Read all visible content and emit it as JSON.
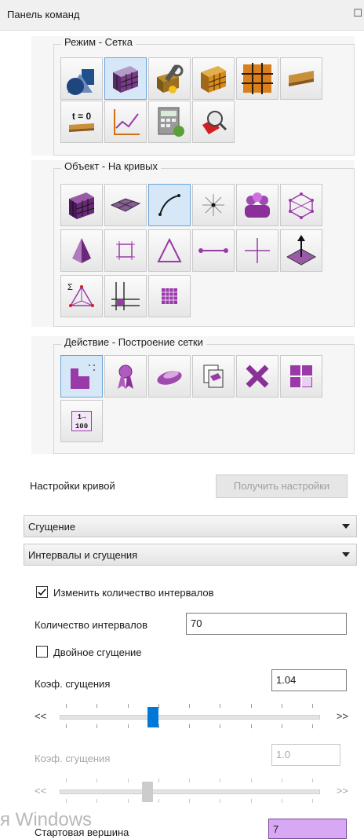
{
  "panel": {
    "title": "Панель команд"
  },
  "groups": {
    "mode": {
      "title": "Режим - Сетка"
    },
    "object": {
      "title": "Объект - На кривых"
    },
    "action": {
      "title": "Действие - Построение сетки"
    }
  },
  "mode_buttons": [
    "geometry-icon",
    "block-mesh-icon",
    "mesh-settings-icon",
    "hexa-block-icon",
    "grid-edges-icon",
    "bar-element-icon",
    "time-zero-icon",
    "graph-icon",
    "calculator-icon",
    "inspect-icon"
  ],
  "time_label": "t = 0",
  "object_buttons": [
    "volume-mesh-icon",
    "surface-mesh-icon",
    "curve-mesh-icon",
    "vertex-star-icon",
    "parts-icon",
    "topology-icon",
    "prism-icon",
    "edge-rect-icon",
    "triangle-icon",
    "line-segment-icon",
    "point-cross-icon",
    "normal-vector-icon",
    "sigma-tetra-icon",
    "structure-lines-icon",
    "grid-small-icon"
  ],
  "action_buttons": [
    "build-mesh-icon",
    "ribbon-icon",
    "smooth-icon",
    "copy-icon",
    "delete-icon",
    "split-block-icon",
    "numbering-icon"
  ],
  "numbering_label": "1→ 100",
  "curve_settings": {
    "label": "Настройки кривой",
    "get_button": "Получить настройки"
  },
  "combo1": {
    "value": "Сгущение"
  },
  "combo2": {
    "value": "Интервалы и сгущения"
  },
  "change_intervals": {
    "label": "Изменить количество интервалов",
    "checked": true
  },
  "interval_count": {
    "label": "Количество интервалов",
    "value": "70"
  },
  "double_bunching": {
    "label": "Двойное сгущение",
    "checked": false
  },
  "coef1": {
    "label": "Коэф. сгущения",
    "value": "1.04",
    "slider_level": 0.36
  },
  "coef2": {
    "label": "Коэф. сгущения",
    "value": "1.0",
    "slider_level": 0.34
  },
  "slider_left": "<<",
  "slider_right": ">>",
  "start_vertex": {
    "label": "Стартовая вершина",
    "value": "7"
  },
  "watermark": "я Windows",
  "colors": {
    "accent": "#0078d7",
    "highlight_field": "#d9a8f5",
    "mesh_purple": "#7b2d8f"
  }
}
